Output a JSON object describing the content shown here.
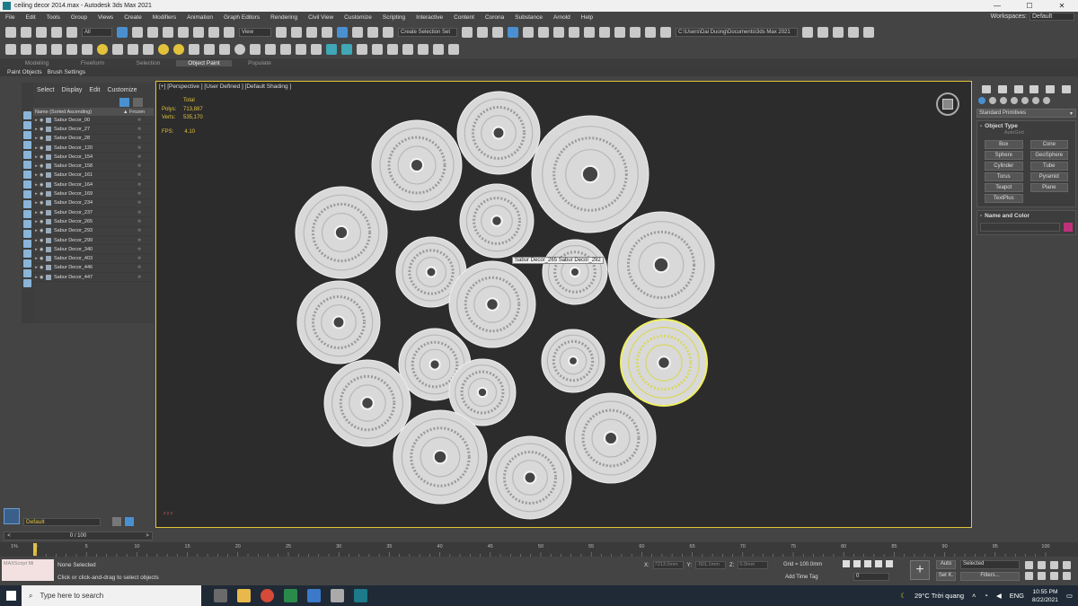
{
  "window": {
    "title": "ceiling decor 2014.max - Autodesk 3ds Max 2021",
    "min": "—",
    "max": "☐",
    "close": "✕"
  },
  "menu": {
    "items": [
      "File",
      "Edit",
      "Tools",
      "Group",
      "Views",
      "Create",
      "Modifiers",
      "Animation",
      "Graph Editors",
      "Rendering",
      "Civil View",
      "Customize",
      "Scripting",
      "Interactive",
      "Content",
      "Corona",
      "Substance",
      "Arnold",
      "Help"
    ],
    "workspaces_label": "Workspaces:",
    "workspaces_value": "Default"
  },
  "toolbar": {
    "filter_all": "All",
    "view_select": "View",
    "selection_set": "Create Selection Set",
    "project_path": "C:\\Users\\Dai Duong\\Documents\\3ds Max 2021"
  },
  "ribbon": {
    "tabs": [
      "Modeling",
      "Freeform",
      "Selection",
      "Object Paint",
      "Populate"
    ],
    "active": "Object Paint",
    "sub": [
      "Paint Objects",
      "Brush Settings"
    ]
  },
  "scene_explorer": {
    "menus": [
      "Select",
      "Display",
      "Edit",
      "Customize"
    ],
    "col_name": "Name (Sorted Ascending)",
    "col_frozen": "▲ Frozen",
    "rows": [
      "Sabur Decor_00",
      "Sabur Decor_27",
      "Sabur Decor_28",
      "Sabur Decor_120",
      "Sabur Decor_154",
      "Sabur Decor_158",
      "Sabur Decor_161",
      "Sabur Decor_164",
      "Sabur Decor_169",
      "Sabur Decor_234",
      "Sabur Decor_237",
      "Sabur Decor_265",
      "Sabur Decor_293",
      "Sabur Decor_299",
      "Sabur Decor_340",
      "Sabur Decor_403",
      "Sabur Decor_446",
      "Sabur Decor_447"
    ]
  },
  "layer": {
    "name": "Default"
  },
  "frame": {
    "value": "0 / 100",
    "prev": "<",
    "next": ">"
  },
  "viewport": {
    "label": "[+] [Perspective ] [User Defined ] [Default Shading ]",
    "stats_total": "Total",
    "polys_label": "Polys:",
    "polys_value": "713,887",
    "verts_label": "Verts:",
    "verts_value": "535,170",
    "fps_label": "FPS:",
    "fps_value": "4.10",
    "tooltip": "Sabur Decor_265  Sabur Decor_292",
    "axis": "z y x"
  },
  "command_panel": {
    "category": "Standard Primitives",
    "object_type": "Object Type",
    "autogrid": "AutoGrid",
    "buttons": [
      "Box",
      "Cone",
      "Sphere",
      "GeoSphere",
      "Cylinder",
      "Tube",
      "Torus",
      "Pyramid",
      "Teapot",
      "Plane",
      "TextPlus"
    ],
    "name_color": "Name and Color"
  },
  "timeline": {
    "ticks": [
      "0",
      "5",
      "10",
      "15",
      "20",
      "25",
      "30",
      "35",
      "40",
      "45",
      "50",
      "55",
      "60",
      "65",
      "70",
      "75",
      "80",
      "85",
      "90",
      "95",
      "100"
    ],
    "start_label": "1%"
  },
  "status": {
    "maxscript": "MAXScript Mi",
    "selected": "None Selected",
    "prompt": "Click or click-and-drag to select objects",
    "x_label": "X:",
    "y_label": "Y:",
    "z_label": "Z:",
    "x_value": "7213.0mm",
    "y_value": "-501.1mm",
    "z_value": "0.0mm",
    "grid": "Grid = 100.0mm",
    "add_time_tag": "Add Time Tag",
    "frame_field": "0",
    "auto": "Auto",
    "setk": "Set K.",
    "selected_dd": "Selected",
    "filters": "Filters..."
  },
  "taskbar": {
    "search_placeholder": "Type here to search",
    "weather": "29°C  Trời quang",
    "lang": "ENG",
    "time": "10:55 PM",
    "date": "8/22/2021"
  }
}
